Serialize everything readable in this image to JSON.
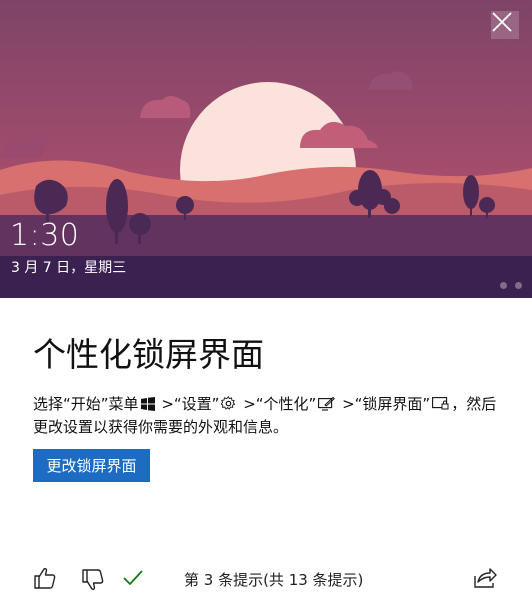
{
  "hero": {
    "time": "1:30",
    "date": "3 月 7 日，星期三"
  },
  "close_icon": "close-icon",
  "content": {
    "title": "个性化锁屏界面",
    "desc_part1": "选择“开始”菜单",
    "desc_part2": " >“设置”",
    "desc_part3": " >“个性化”",
    "desc_part4": " >“锁屏界面”",
    "desc_part5": "，然后更改设置以获得你需要的外观和信息。",
    "button_label": "更改锁屏界面"
  },
  "footer": {
    "tip_text": "第 3 条提示(共 13 条提示)",
    "icons": [
      "thumbs-up-icon",
      "thumbs-down-icon",
      "check-icon",
      "share-icon"
    ],
    "check_color": "#107c10"
  },
  "colors": {
    "accent": "#1d6cc2",
    "sky_top": "#8a4870",
    "sky_bottom": "#c45e72"
  }
}
